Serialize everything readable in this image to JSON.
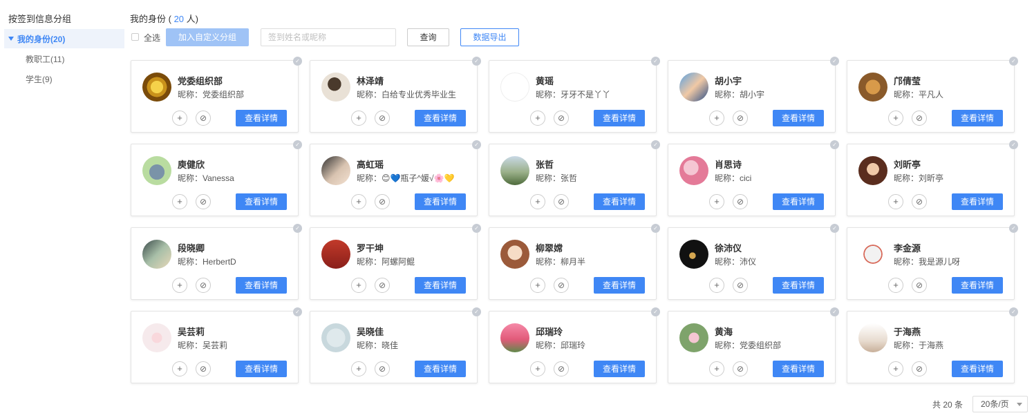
{
  "sidebar": {
    "title": "按签到信息分组",
    "group_label": "我的身份(20)",
    "sub_items": [
      {
        "label": "教职工(11)"
      },
      {
        "label": "学生(9)"
      }
    ]
  },
  "header": {
    "title_prefix": "我的身份 (",
    "count": "20",
    "title_suffix": "人)"
  },
  "toolbar": {
    "select_all_label": "全选",
    "add_group_label": "加入自定义分组",
    "search_placeholder": "签到姓名或昵称",
    "search_value": "",
    "query_label": "查询",
    "export_label": "数据导出"
  },
  "card_labels": {
    "nick_prefix": "昵称：",
    "add_icon": "+",
    "ban_icon": "⊘",
    "detail_label": "查看详情",
    "check_icon": "✓"
  },
  "people": [
    {
      "name": "党委组织部",
      "nick": "党委组织部",
      "avatar": "emblem"
    },
    {
      "name": "林泽靖",
      "nick": "白给专业优秀毕业生",
      "avatar": "silhouette"
    },
    {
      "name": "黄瑶",
      "nick": "牙牙不是丫丫",
      "avatar": "sheep"
    },
    {
      "name": "胡小宇",
      "nick": "胡小宇",
      "avatar": "family"
    },
    {
      "name": "邝倩莹",
      "nick": "平凡人",
      "avatar": "lion"
    },
    {
      "name": "庾健欣",
      "nick": "Vanessa",
      "avatar": "hippo"
    },
    {
      "name": "高虹瑶",
      "nick": "😊💙瓶子^媛√🌸💛",
      "avatar": "girl"
    },
    {
      "name": "张哲",
      "nick": "张哲",
      "avatar": "field"
    },
    {
      "name": "肖思诗",
      "nick": "cici",
      "avatar": "blossom"
    },
    {
      "name": "刘昕亭",
      "nick": "刘昕亭",
      "avatar": "portrait"
    },
    {
      "name": "段晓卿",
      "nick": "HerbertD",
      "avatar": "anime"
    },
    {
      "name": "罗干坤",
      "nick": "阿螺阿鲲",
      "avatar": "red"
    },
    {
      "name": "柳翠嫦",
      "nick": "柳月半",
      "avatar": "cartoon"
    },
    {
      "name": "徐沛仪",
      "nick": "沛仪",
      "avatar": "dark"
    },
    {
      "name": "李金源",
      "nick": "我是源儿呀",
      "avatar": "bird"
    },
    {
      "name": "吴芸莉",
      "nick": "吴芸莉",
      "avatar": "flower"
    },
    {
      "name": "吴晓佳",
      "nick": "晓佳",
      "avatar": "sketch"
    },
    {
      "name": "邱瑞玲",
      "nick": "邱瑞玲",
      "avatar": "tulips"
    },
    {
      "name": "黄海",
      "nick": "党委组织部",
      "avatar": "lotus"
    },
    {
      "name": "于海燕",
      "nick": "于海燕",
      "avatar": "baby"
    }
  ],
  "pagination": {
    "total_text": "共 20 条",
    "page_size": "20条/页"
  }
}
